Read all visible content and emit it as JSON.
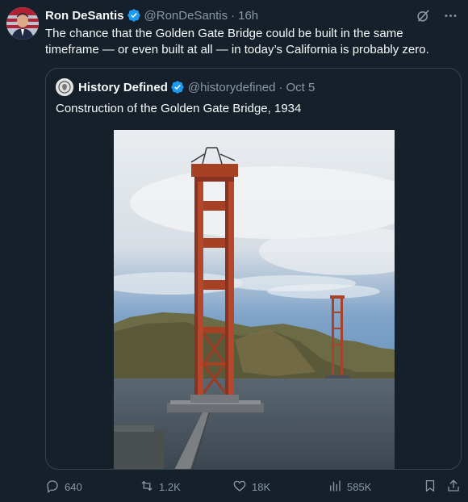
{
  "tweet": {
    "author_name": "Ron DeSantis",
    "handle": "@RonDeSantis",
    "separator": "·",
    "time": "16h",
    "text": "The chance that the Golden Gate Bridge could be built in the same timeframe — or even built at all — in today’s California is probably zero."
  },
  "quote": {
    "author_name": "History Defined",
    "handle": "@historydefined",
    "separator": "·",
    "date": "Oct 5",
    "text": "Construction of the Golden Gate Bridge, 1934"
  },
  "actions": {
    "replies": "640",
    "retweets": "1.2K",
    "likes": "18K",
    "views": "585K"
  },
  "icons": [
    "verified-badge-icon",
    "grok-icon",
    "more-icon",
    "reply-icon",
    "retweet-icon",
    "like-icon",
    "views-icon",
    "bookmark-icon",
    "share-icon"
  ],
  "colors": {
    "background": "#15202b",
    "verified": "#1d9bf0",
    "secondary_text": "#8b98a5",
    "border": "#38444d",
    "bridge": "#b5472b"
  }
}
